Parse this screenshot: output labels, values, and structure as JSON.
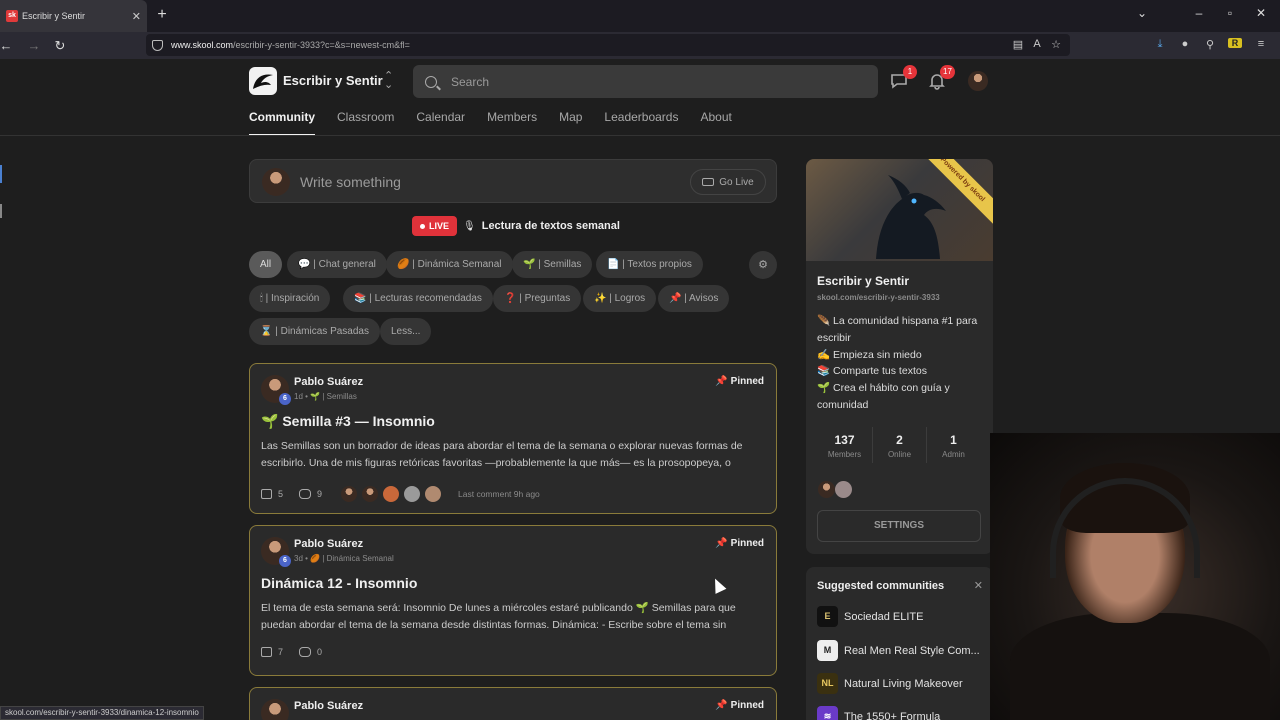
{
  "browser": {
    "tab_title": "Escribir y Sentir",
    "tab_favicon": "sk",
    "url_domain": "www.skool.com",
    "url_path": "/escribir-y-sentir-3933?c=&s=newest-cm&fl=",
    "status_url": "skool.com/escribir-y-sentir-3933/dinamica-12-insomnio"
  },
  "header": {
    "group_name": "Escribir y Sentir",
    "search_placeholder": "Search",
    "chat_badge": "1",
    "notifications_badge": "17"
  },
  "nav_tabs": [
    "Community",
    "Classroom",
    "Calendar",
    "Members",
    "Map",
    "Leaderboards",
    "About"
  ],
  "composer": {
    "placeholder": "Write something",
    "go_live_label": "Go Live"
  },
  "live": {
    "badge": "LIVE",
    "icon": "🎙",
    "title": "Lectura de textos semanal"
  },
  "filters": [
    "All",
    "💬 | Chat general",
    "🏉 | Dinámica Semanal",
    "🌱 | Semillas",
    "📄 | Textos propios",
    "🕯 | Inspiración",
    "📚 | Lecturas recomendadas",
    "❓ | Preguntas",
    "✨ | Logros",
    "📌 | Avisos",
    "⌛ | Dinámicas Pasadas",
    "Less..."
  ],
  "posts": [
    {
      "author": "Pablo Suárez",
      "level": "6",
      "meta": "1d • 🌱 | Semillas",
      "pinned": "Pinned",
      "title": "🌱 Semilla #3 — Insomnio",
      "body": "Las Semillas son un borrador de ideas para abordar el tema de la semana o explorar nuevas formas de escribirlo. Una de mis figuras retóricas favoritas —probablemente la que más— es la prosopopeya, o",
      "likes": "5",
      "comments": "9",
      "last_comment": "Last comment 9h ago"
    },
    {
      "author": "Pablo Suárez",
      "level": "6",
      "meta": "3d • 🏉 | Dinámica Semanal",
      "pinned": "Pinned",
      "title": "Dinámica 12 - Insomnio",
      "body": "El tema de esta semana será: Insomnio De lunes a miércoles estaré publicando 🌱 Semillas para que puedan abordar el tema de la semana desde distintas formas. Dinámica: - Escribe sobre el tema sin",
      "likes": "7",
      "comments": "0"
    },
    {
      "author": "Pablo Suárez",
      "pinned": "Pinned"
    }
  ],
  "about": {
    "powered_by": "Powered by skool",
    "name": "Escribir y Sentir",
    "url": "skool.com/escribir-y-sentir-3933",
    "desc_lines": [
      "🪶 La comunidad hispana #1 para escribir",
      "✍️ Empieza sin miedo",
      "📚 Comparte tus textos",
      "🌱 Crea el hábito con guía y comunidad"
    ],
    "stats": [
      {
        "value": "137",
        "label": "Members"
      },
      {
        "value": "2",
        "label": "Online"
      },
      {
        "value": "1",
        "label": "Admin"
      }
    ],
    "settings_label": "SETTINGS"
  },
  "suggested": {
    "title": "Suggested communities",
    "items": [
      {
        "icon": "E",
        "name": "Sociedad ELITE"
      },
      {
        "icon": "M",
        "name": "Real Men Real Style Com..."
      },
      {
        "icon": "NL",
        "name": "Natural Living Makeover"
      },
      {
        "icon": "≋",
        "name": "The 1550+ Formula"
      }
    ]
  },
  "colors": {
    "live_red": "#e0323a",
    "pinned_border": "#8a7b3a",
    "level_blue": "#4a64c8",
    "badge_red": "#e5343a"
  }
}
